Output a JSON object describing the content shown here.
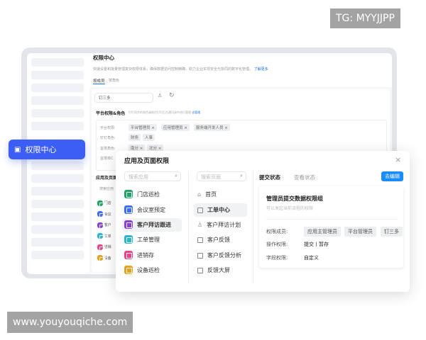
{
  "watermarks": {
    "top": "TG: MYYJJPP",
    "bottom": "www.youyouqiche.com"
  },
  "floating_nav": {
    "label": "权限中心",
    "color": "#3d5ef5"
  },
  "main": {
    "title": "权限中心",
    "description": "快速设置和批量管理复杂权限体系，确保数据访问控制精确，助力企业实现安全与协同的数字化管理。",
    "learn_more": "了解更多",
    "tabs": [
      "按成员",
      "按角色"
    ],
    "member_search": "钉三多",
    "platform_section": {
      "title": "平台权限&角色",
      "hint": "钉钉同步的角色请前往钉钉后台通讯录中进行管理",
      "link": "去管理",
      "rows": [
        {
          "label": "平台权限:",
          "tags": [
            "平台管理员 ×",
            "应用管理员 ×",
            "服务端开发人员 ×"
          ]
        },
        {
          "label": "钉钉角色:",
          "tags": [
            "财务",
            "人事"
          ]
        },
        {
          "label": "宜搭角色:",
          "tags": [
            "南分 ×",
            "北分 ×"
          ]
        },
        {
          "label": "宜搭核C"
        }
      ]
    },
    "apps_section": {
      "title": "应用及页面",
      "search": "搜索应用",
      "items": [
        "门店",
        "会议",
        "客户",
        "工单",
        "进销",
        "设备"
      ]
    }
  },
  "modal": {
    "title": "应用及页面权限",
    "app_search_placeholder": "搜索应用",
    "page_search_placeholder": "搜索页面",
    "apps": [
      {
        "label": "门店巡检",
        "color": "#1fa463"
      },
      {
        "label": "会议室预定",
        "color": "#3d6ef5"
      },
      {
        "label": "客户拜访跟进",
        "color": "#8a3fd8"
      },
      {
        "label": "工单管理",
        "color": "#2bb6c9"
      },
      {
        "label": "进销存",
        "color": "#e9448a"
      },
      {
        "label": "设备巡检",
        "color": "#e8a21a"
      }
    ],
    "selected_app": 2,
    "pages": [
      "首页",
      "工单中心",
      "客户拜访计划",
      "客户反馈",
      "客户反馈分析",
      "反馈大屏"
    ],
    "selected_page": 1,
    "tabs": [
      "提交状态",
      "查看状态"
    ],
    "edit_button": "去编辑",
    "card": {
      "title": "管理员提交数据权限组",
      "subtitle": "可以发起当前流程的权限",
      "members_label": "权限成员:",
      "members": [
        "应用主管理员",
        "平台管理员",
        "钉三多"
      ],
      "ops_label": "操作权限:",
      "ops_value": "提交丨暂存",
      "fields_label": "字段权限:",
      "fields_value": "自定义"
    }
  }
}
